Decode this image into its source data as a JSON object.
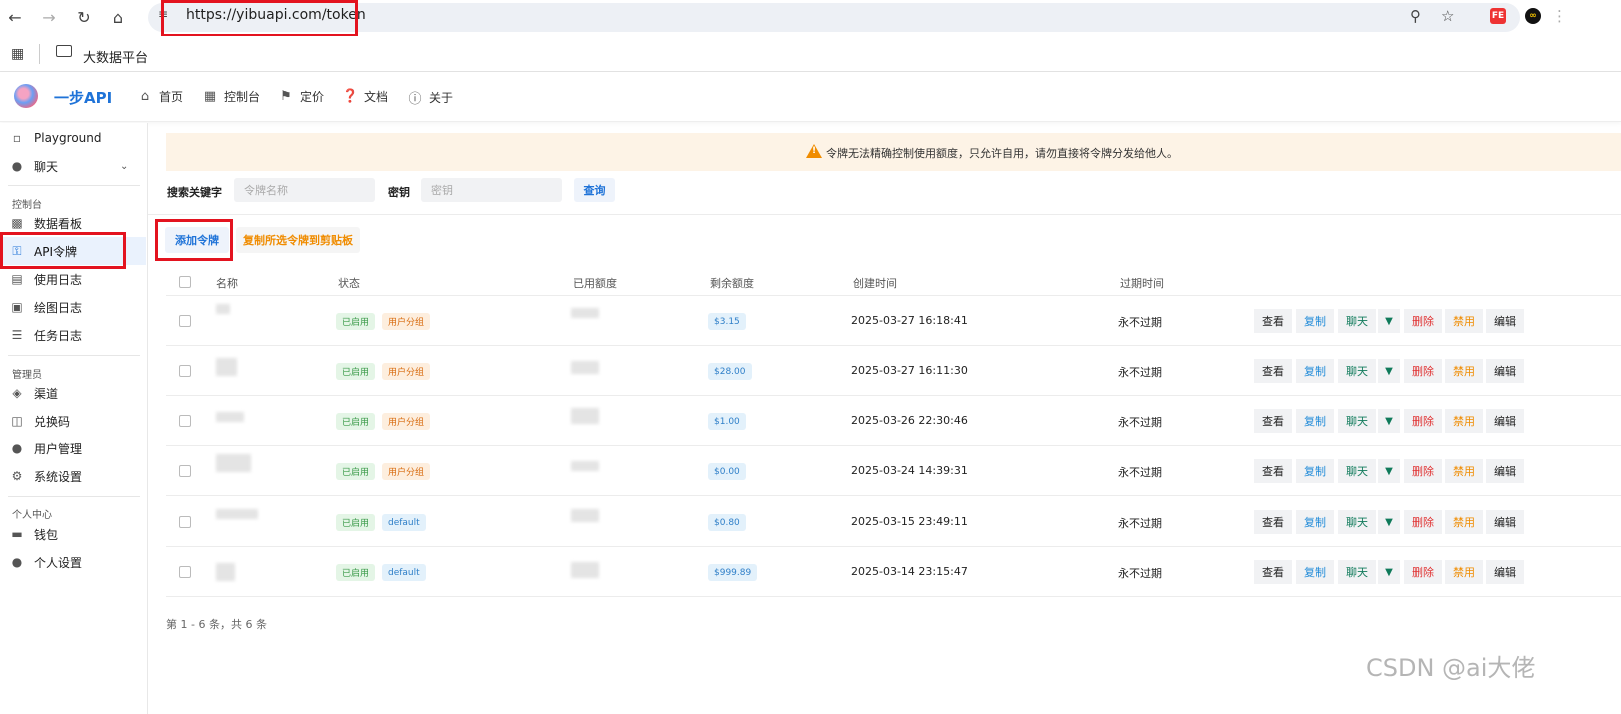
{
  "browser": {
    "url": "https://yibuapi.com/token",
    "bookmark_folder": "大数据平台"
  },
  "app": {
    "brand": "一步API",
    "nav": [
      {
        "label": "首页",
        "icon": "home-icon"
      },
      {
        "label": "控制台",
        "icon": "terminal-icon"
      },
      {
        "label": "定价",
        "icon": "tag-icon"
      },
      {
        "label": "文档",
        "icon": "help-icon"
      },
      {
        "label": "关于",
        "icon": "info-icon"
      }
    ]
  },
  "sidebar": {
    "items": [
      {
        "label": "Playground",
        "icon": "message-icon"
      },
      {
        "label": "聊天",
        "icon": "chat-icon"
      }
    ],
    "section_console": "控制台",
    "console_items": [
      {
        "label": "数据看板",
        "icon": "dashboard-icon"
      },
      {
        "label": "API令牌",
        "icon": "key-icon"
      },
      {
        "label": "使用日志",
        "icon": "bar-chart-icon"
      },
      {
        "label": "绘图日志",
        "icon": "image-icon"
      },
      {
        "label": "任务日志",
        "icon": "task-list-icon"
      }
    ],
    "section_admin": "管理员",
    "admin_items": [
      {
        "label": "渠道",
        "icon": "layers-icon"
      },
      {
        "label": "兑换码",
        "icon": "gift-icon"
      },
      {
        "label": "用户管理",
        "icon": "user-icon"
      },
      {
        "label": "系统设置",
        "icon": "gear-icon"
      }
    ],
    "section_personal": "个人中心",
    "personal_items": [
      {
        "label": "钱包",
        "icon": "wallet-icon"
      },
      {
        "label": "个人设置",
        "icon": "user-settings-icon"
      }
    ]
  },
  "notice": "令牌无法精确控制使用额度，只允许自用，请勿直接将令牌分发给他人。",
  "search": {
    "keyword_label": "搜索关键字",
    "keyword_placeholder": "令牌名称",
    "key_label": "密钥",
    "key_placeholder": "密钥",
    "query_button": "查询"
  },
  "actions": {
    "add_token": "添加令牌",
    "copy_selected": "复制所选令牌到剪贴板"
  },
  "table": {
    "headers": [
      "名称",
      "状态",
      "已用额度",
      "剩余额度",
      "创建时间",
      "过期时间"
    ],
    "rows": [
      {
        "status": "已启用",
        "group": "用户分组",
        "remaining": "$3.15",
        "created": "2025-03-27 16:18:41",
        "expires": "永不过期"
      },
      {
        "status": "已启用",
        "group": "用户分组",
        "remaining": "$28.00",
        "created": "2025-03-27 16:11:30",
        "expires": "永不过期"
      },
      {
        "status": "已启用",
        "group": "用户分组",
        "remaining": "$1.00",
        "created": "2025-03-26 22:30:46",
        "expires": "永不过期"
      },
      {
        "status": "已启用",
        "group": "用户分组",
        "remaining": "$0.00",
        "created": "2025-03-24 14:39:31",
        "expires": "永不过期"
      },
      {
        "status": "已启用",
        "group": "default",
        "remaining": "$0.80",
        "created": "2025-03-15 23:49:11",
        "expires": "永不过期"
      },
      {
        "status": "已启用",
        "group": "default",
        "remaining": "$999.89",
        "created": "2025-03-14 23:15:47",
        "expires": "永不过期"
      }
    ],
    "row_actions": [
      "查看",
      "复制",
      "聊天",
      "删除",
      "禁用",
      "编辑"
    ]
  },
  "pagination": "第 1 - 6 条，共 6 条",
  "watermark": "CSDN @ai大佬",
  "colors": {
    "brand": "#1f73d8",
    "highlight_box": "#e3131f",
    "warning": "#f08c00"
  }
}
